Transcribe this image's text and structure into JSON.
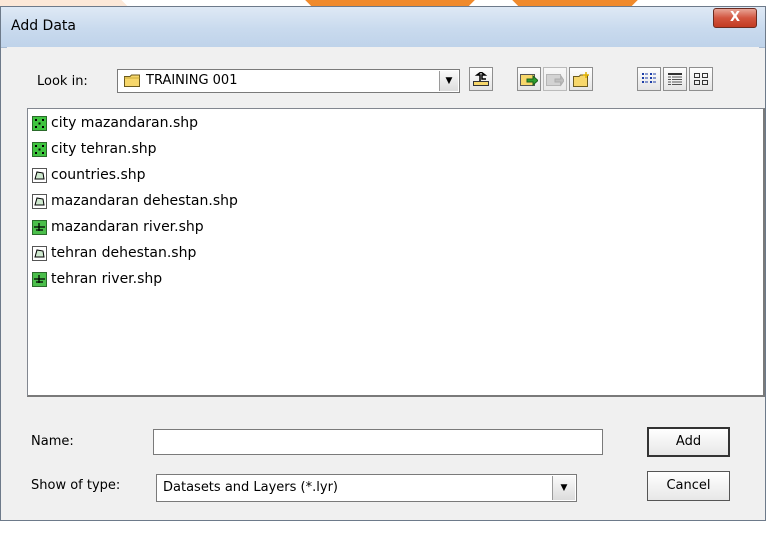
{
  "dialog": {
    "title": "Add Data",
    "close_label": "X"
  },
  "toolbar": {
    "look_in_label": "Look in:",
    "look_in_value": "TRAINING 001",
    "buttons": [
      {
        "icon": "up-one-level-icon"
      },
      {
        "icon": "connect-to-folder-icon"
      },
      {
        "icon": "disconnect-folder-icon"
      },
      {
        "icon": "new-folder-icon"
      },
      {
        "icon": "list-view-icon"
      },
      {
        "icon": "details-view-icon"
      },
      {
        "icon": "thumbnails-view-icon"
      }
    ]
  },
  "files": [
    {
      "name": "city mazandaran.shp",
      "type": "point"
    },
    {
      "name": "city tehran.shp",
      "type": "point"
    },
    {
      "name": "countries.shp",
      "type": "polygon"
    },
    {
      "name": "mazandaran dehestan.shp",
      "type": "polygon"
    },
    {
      "name": "mazandaran river.shp",
      "type": "line"
    },
    {
      "name": "tehran dehestan.shp",
      "type": "polygon"
    },
    {
      "name": "tehran river.shp",
      "type": "line"
    }
  ],
  "form": {
    "name_label": "Name:",
    "name_value": "",
    "type_label": "Show of type:",
    "type_value": "Datasets and Layers (*.lyr)",
    "add_label": "Add",
    "cancel_label": "Cancel"
  },
  "colors": {
    "point_icon": "#3fc43f",
    "polygon_icon": "#ffffff",
    "line_icon": "#4bbf4b",
    "title_bar": "#c9daee",
    "close_button": "#c9452b",
    "folder": "#f7d76b",
    "decor_orange": "#f08a2c"
  }
}
